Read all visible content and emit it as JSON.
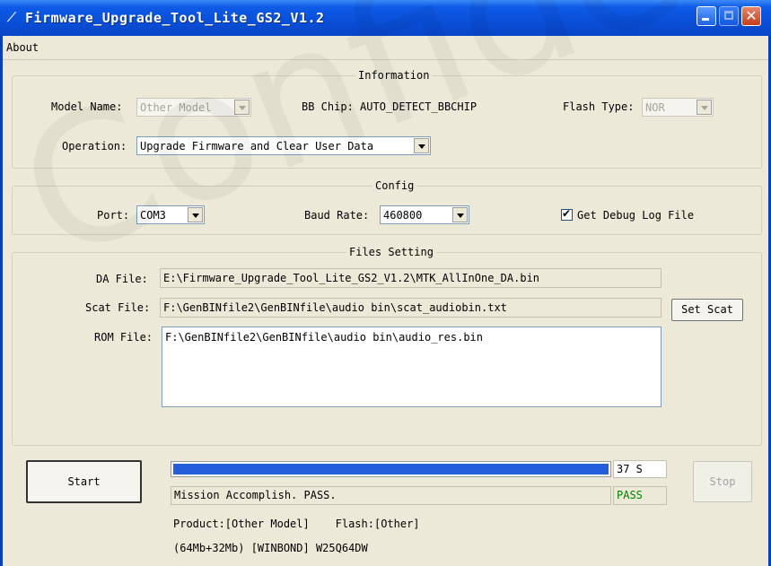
{
  "window": {
    "title": "Firmware_Upgrade_Tool_Lite_GS2_V1.2"
  },
  "menu": {
    "about": "About"
  },
  "information": {
    "legend": "Information",
    "model_name_label": "Model Name:",
    "model_name_value": "Other Model",
    "bb_chip_label": "BB Chip:",
    "bb_chip_value": "AUTO_DETECT_BBCHIP",
    "flash_type_label": "Flash Type:",
    "flash_type_value": "NOR",
    "operation_label": "Operation:",
    "operation_value": "Upgrade Firmware and Clear User Data"
  },
  "config": {
    "legend": "Config",
    "port_label": "Port:",
    "port_value": "COM3",
    "baud_label": "Baud Rate:",
    "baud_value": "460800",
    "debug_log_label": "Get Debug Log File",
    "debug_log_checked": true
  },
  "files": {
    "legend": "Files Setting",
    "da_label": "DA File:",
    "da_value": "E:\\Firmware_Upgrade_Tool_Lite_GS2_V1.2\\MTK_AllInOne_DA.bin",
    "scat_label": "Scat File:",
    "scat_value": "F:\\GenBINfile2\\GenBINfile\\audio bin\\scat_audiobin.txt",
    "set_scat": "Set Scat",
    "rom_label": "ROM File:",
    "rom_value": "F:\\GenBINfile2\\GenBINfile\\audio bin\\audio_res.bin"
  },
  "status": {
    "start": "Start",
    "stop": "Stop",
    "progress_fraction": 1.0,
    "time": "37 S",
    "message": "Mission Accomplish. PASS.",
    "result": "PASS",
    "result_color": "#008000",
    "product_line": "Product:[Other Model]    Flash:[Other]",
    "flash_line": "(64Mb+32Mb) [WINBOND] W25Q64DW"
  },
  "watermark": "Confidential",
  "colors": {
    "titlebar": "#0a4fd8",
    "progress": "#245edb",
    "window": "#ece9d8"
  }
}
